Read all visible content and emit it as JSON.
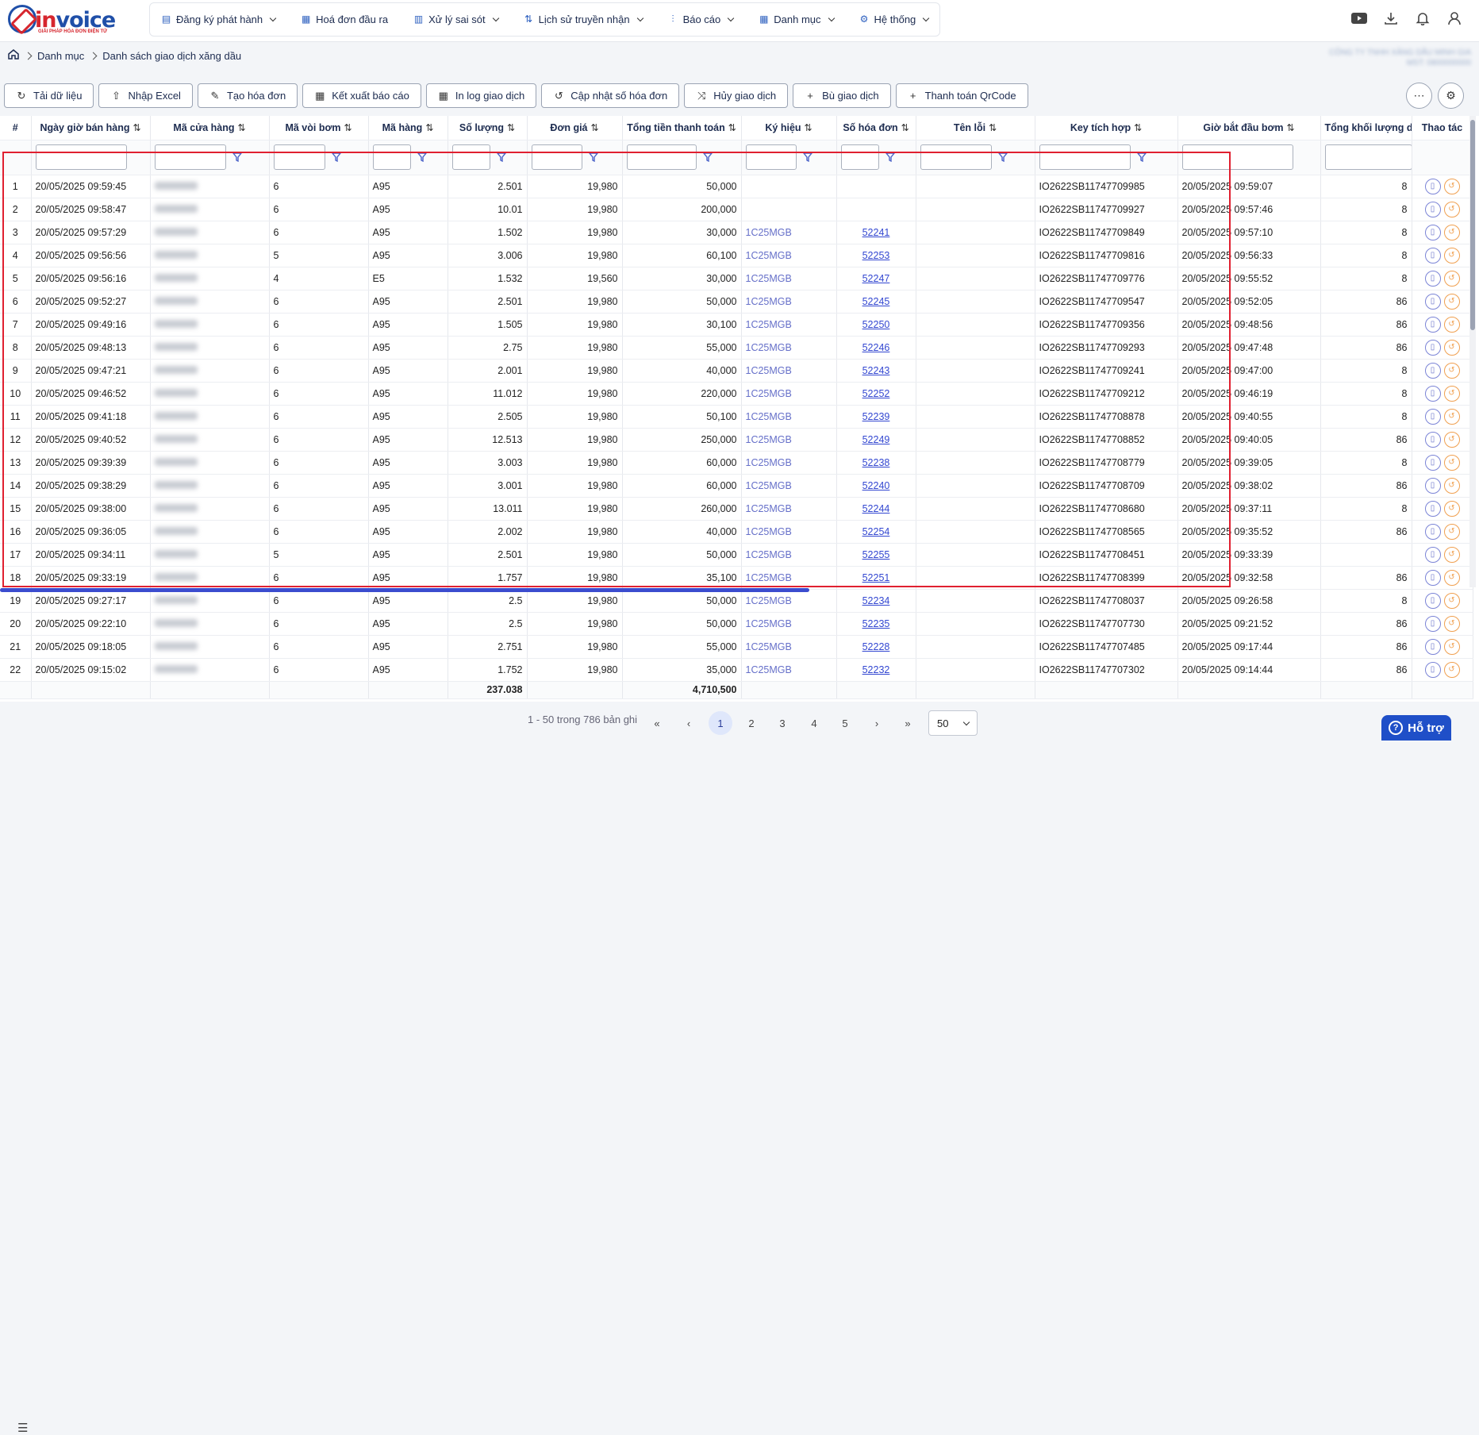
{
  "logo": {
    "text_a": "in",
    "text_b": "voice",
    "subtitle": "GIẢI PHÁP HÓA ĐƠN ĐIỆN TỬ"
  },
  "menu": [
    {
      "label": "Đăng ký phát hành",
      "icon": "file-icon",
      "dropdown": true
    },
    {
      "label": "Hoá đơn đầu ra",
      "icon": "invoice-icon",
      "dropdown": false
    },
    {
      "label": "Xử lý sai sót",
      "icon": "file-edit-icon",
      "dropdown": true
    },
    {
      "label": "Lịch sử truyền nhận",
      "icon": "sort-icon",
      "dropdown": true
    },
    {
      "label": "Báo cáo",
      "icon": "chart-icon",
      "dropdown": true
    },
    {
      "label": "Danh mục",
      "icon": "grid-icon",
      "dropdown": true
    },
    {
      "label": "Hệ thống",
      "icon": "gear-icon",
      "dropdown": true
    }
  ],
  "breadcrumb": [
    "Danh mục",
    "Danh sách giao dịch xăng dầu"
  ],
  "company": {
    "line1": "CÔNG TY TNHH XĂNG DẦU MINH GIA",
    "line2": "MST: 0800000000"
  },
  "toolbar": [
    {
      "label": "Tải dữ liệu",
      "icon": "refresh-icon"
    },
    {
      "label": "Nhập Excel",
      "icon": "upload-icon"
    },
    {
      "label": "Tạo hóa đơn",
      "icon": "pencil-icon"
    },
    {
      "label": "Kết xuất báo cáo",
      "icon": "grid-icon"
    },
    {
      "label": "In log giao dịch",
      "icon": "grid-icon"
    },
    {
      "label": "Cập nhật số hóa đơn",
      "icon": "rotate-icon"
    },
    {
      "label": "Hủy giao dịch",
      "icon": "shuffle-icon"
    },
    {
      "label": "Bù giao dịch",
      "icon": "plus-icon"
    },
    {
      "label": "Thanh toán QrCode",
      "icon": "plus-icon"
    }
  ],
  "columns": [
    "#",
    "Ngày giờ bán hàng",
    "Mã cửa hàng",
    "Mã vòi bơm",
    "Mã hàng",
    "Số lượng",
    "Đơn giá",
    "Tổng tiền thanh toán",
    "Ký hiệu",
    "Số hóa đơn",
    "Tên lỗi",
    "Key tích hợp",
    "Giờ bắt đầu bơm",
    "Tổng khối lượng d",
    "Thao tác"
  ],
  "rows": [
    [
      "1",
      "20/05/2025 09:59:45",
      "6",
      "A95",
      "2.501",
      "19,980",
      "50,000",
      "",
      "",
      "",
      "IO2622SB11747709985",
      "20/05/2025 09:59:07",
      "8"
    ],
    [
      "2",
      "20/05/2025 09:58:47",
      "6",
      "A95",
      "10.01",
      "19,980",
      "200,000",
      "",
      "",
      "",
      "IO2622SB11747709927",
      "20/05/2025 09:57:46",
      "8"
    ],
    [
      "3",
      "20/05/2025 09:57:29",
      "6",
      "A95",
      "1.502",
      "19,980",
      "30,000",
      "1C25MGB",
      "52241",
      "",
      "IO2622SB11747709849",
      "20/05/2025 09:57:10",
      "8"
    ],
    [
      "4",
      "20/05/2025 09:56:56",
      "5",
      "A95",
      "3.006",
      "19,980",
      "60,100",
      "1C25MGB",
      "52253",
      "",
      "IO2622SB11747709816",
      "20/05/2025 09:56:33",
      "8"
    ],
    [
      "5",
      "20/05/2025 09:56:16",
      "4",
      "E5",
      "1.532",
      "19,560",
      "30,000",
      "1C25MGB",
      "52247",
      "",
      "IO2622SB11747709776",
      "20/05/2025 09:55:52",
      "8"
    ],
    [
      "6",
      "20/05/2025 09:52:27",
      "6",
      "A95",
      "2.501",
      "19,980",
      "50,000",
      "1C25MGB",
      "52245",
      "",
      "IO2622SB11747709547",
      "20/05/2025 09:52:05",
      "86"
    ],
    [
      "7",
      "20/05/2025 09:49:16",
      "6",
      "A95",
      "1.505",
      "19,980",
      "30,100",
      "1C25MGB",
      "52250",
      "",
      "IO2622SB11747709356",
      "20/05/2025 09:48:56",
      "86"
    ],
    [
      "8",
      "20/05/2025 09:48:13",
      "6",
      "A95",
      "2.75",
      "19,980",
      "55,000",
      "1C25MGB",
      "52246",
      "",
      "IO2622SB11747709293",
      "20/05/2025 09:47:48",
      "86"
    ],
    [
      "9",
      "20/05/2025 09:47:21",
      "6",
      "A95",
      "2.001",
      "19,980",
      "40,000",
      "1C25MGB",
      "52243",
      "",
      "IO2622SB11747709241",
      "20/05/2025 09:47:00",
      "8"
    ],
    [
      "10",
      "20/05/2025 09:46:52",
      "6",
      "A95",
      "11.012",
      "19,980",
      "220,000",
      "1C25MGB",
      "52252",
      "",
      "IO2622SB11747709212",
      "20/05/2025 09:46:19",
      "8"
    ],
    [
      "11",
      "20/05/2025 09:41:18",
      "6",
      "A95",
      "2.505",
      "19,980",
      "50,100",
      "1C25MGB",
      "52239",
      "",
      "IO2622SB11747708878",
      "20/05/2025 09:40:55",
      "8"
    ],
    [
      "12",
      "20/05/2025 09:40:52",
      "6",
      "A95",
      "12.513",
      "19,980",
      "250,000",
      "1C25MGB",
      "52249",
      "",
      "IO2622SB11747708852",
      "20/05/2025 09:40:05",
      "86"
    ],
    [
      "13",
      "20/05/2025 09:39:39",
      "6",
      "A95",
      "3.003",
      "19,980",
      "60,000",
      "1C25MGB",
      "52238",
      "",
      "IO2622SB11747708779",
      "20/05/2025 09:39:05",
      "8"
    ],
    [
      "14",
      "20/05/2025 09:38:29",
      "6",
      "A95",
      "3.001",
      "19,980",
      "60,000",
      "1C25MGB",
      "52240",
      "",
      "IO2622SB11747708709",
      "20/05/2025 09:38:02",
      "86"
    ],
    [
      "15",
      "20/05/2025 09:38:00",
      "6",
      "A95",
      "13.011",
      "19,980",
      "260,000",
      "1C25MGB",
      "52244",
      "",
      "IO2622SB11747708680",
      "20/05/2025 09:37:11",
      "8"
    ],
    [
      "16",
      "20/05/2025 09:36:05",
      "6",
      "A95",
      "2.002",
      "19,980",
      "40,000",
      "1C25MGB",
      "52254",
      "",
      "IO2622SB11747708565",
      "20/05/2025 09:35:52",
      "86"
    ],
    [
      "17",
      "20/05/2025 09:34:11",
      "5",
      "A95",
      "2.501",
      "19,980",
      "50,000",
      "1C25MGB",
      "52255",
      "",
      "IO2622SB11747708451",
      "20/05/2025 09:33:39",
      ""
    ],
    [
      "18",
      "20/05/2025 09:33:19",
      "6",
      "A95",
      "1.757",
      "19,980",
      "35,100",
      "1C25MGB",
      "52251",
      "",
      "IO2622SB11747708399",
      "20/05/2025 09:32:58",
      "86"
    ],
    [
      "19",
      "20/05/2025 09:27:17",
      "6",
      "A95",
      "2.5",
      "19,980",
      "50,000",
      "1C25MGB",
      "52234",
      "",
      "IO2622SB11747708037",
      "20/05/2025 09:26:58",
      "8"
    ],
    [
      "20",
      "20/05/2025 09:22:10",
      "6",
      "A95",
      "2.5",
      "19,980",
      "50,000",
      "1C25MGB",
      "52235",
      "",
      "IO2622SB11747707730",
      "20/05/2025 09:21:52",
      "86"
    ],
    [
      "21",
      "20/05/2025 09:18:05",
      "6",
      "A95",
      "2.751",
      "19,980",
      "55,000",
      "1C25MGB",
      "52228",
      "",
      "IO2622SB11747707485",
      "20/05/2025 09:17:44",
      "86"
    ],
    [
      "22",
      "20/05/2025 09:15:02",
      "6",
      "A95",
      "1.752",
      "19,980",
      "35,000",
      "1C25MGB",
      "52232",
      "",
      "IO2622SB11747707302",
      "20/05/2025 09:14:44",
      "86"
    ]
  ],
  "totals": {
    "quantity": "237.038",
    "amount": "4,710,500"
  },
  "pagination": {
    "info": "1 - 50 trong 786 bản ghi",
    "pages": [
      "1",
      "2",
      "3",
      "4",
      "5"
    ],
    "current": "1",
    "page_size": "50"
  },
  "help": {
    "label": "Hỗ trợ"
  }
}
